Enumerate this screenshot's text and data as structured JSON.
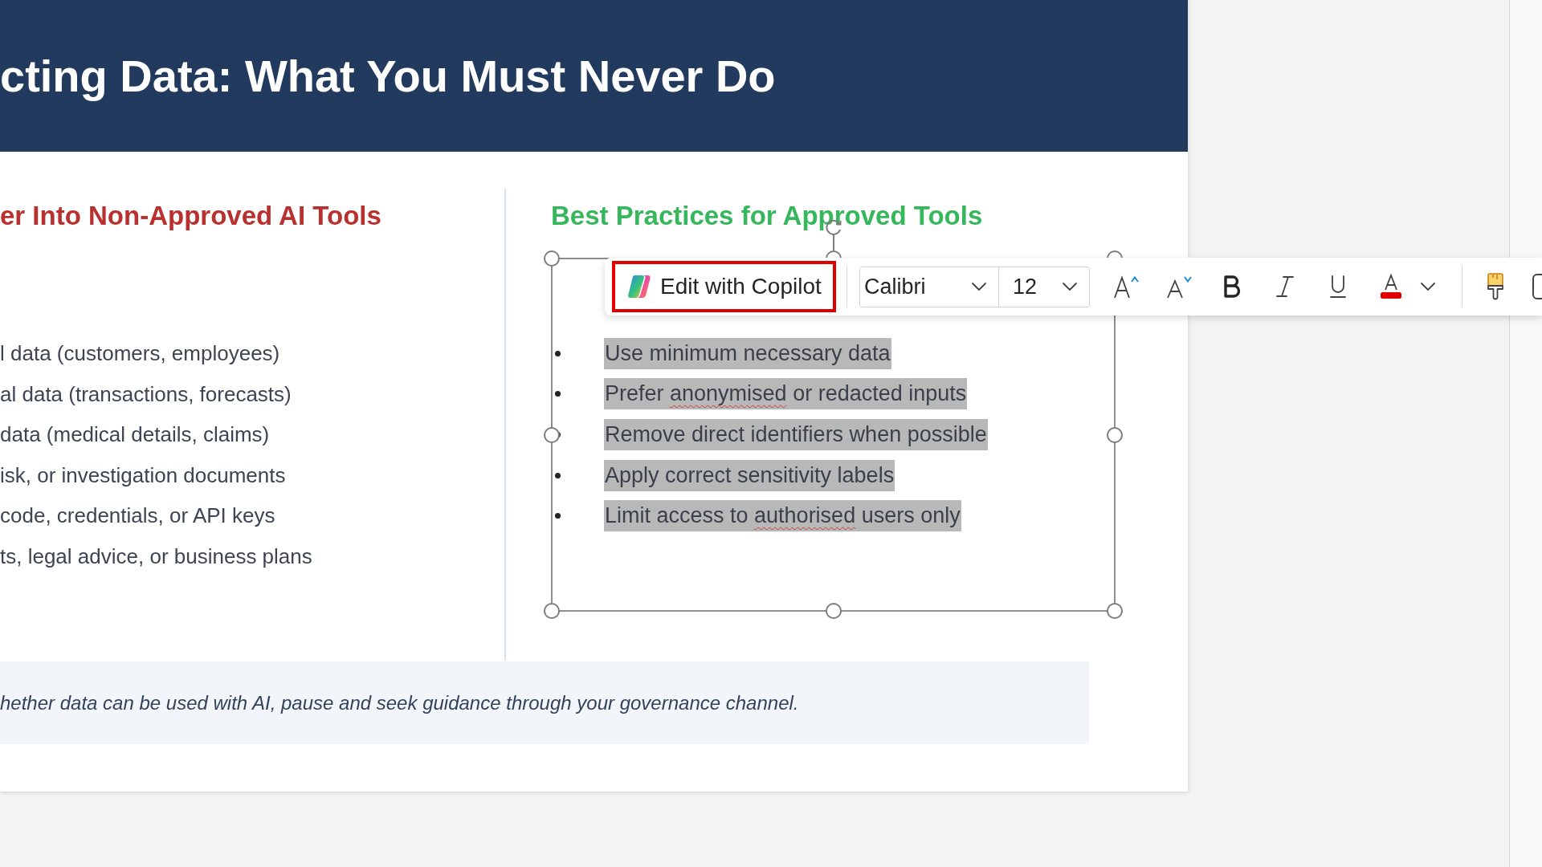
{
  "slide": {
    "title": "cting Data: What You Must Never Do",
    "left_column": {
      "heading": "er Into Non-Approved AI Tools",
      "items": [
        "l data (customers, employees)",
        "al data (transactions, forecasts)",
        "data (medical details, claims)",
        "isk, or investigation documents",
        "code, credentials, or API keys",
        "ts, legal advice, or business plans"
      ]
    },
    "right_column": {
      "heading": "Best Practices for Approved Tools",
      "text_box": {
        "selected": true,
        "items": [
          {
            "selected": true,
            "segments": [
              {
                "text": "Use minimum necessary data",
                "misspelled": false
              }
            ]
          },
          {
            "selected": true,
            "segments": [
              {
                "text": "Prefer ",
                "misspelled": false
              },
              {
                "text": "anonymised",
                "misspelled": true
              },
              {
                "text": " or redacted inputs",
                "misspelled": false
              }
            ]
          },
          {
            "selected": true,
            "segments": [
              {
                "text": "Remove direct identifiers when possible",
                "misspelled": false
              }
            ]
          },
          {
            "selected": true,
            "segments": [
              {
                "text": "Apply correct sensitivity labels",
                "misspelled": false
              }
            ]
          },
          {
            "selected": true,
            "segments": [
              {
                "text": "Limit access to ",
                "misspelled": false
              },
              {
                "text": "authorised",
                "misspelled": true
              },
              {
                "text": " users only",
                "misspelled": false
              }
            ]
          }
        ]
      }
    },
    "note": "hether data can be used with AI, pause and seek guidance through your governance channel."
  },
  "floating_toolbar": {
    "copilot_button": {
      "label": "Edit with Copilot",
      "highlighted": true
    },
    "font_name": "Calibri",
    "font_size": "12"
  }
}
